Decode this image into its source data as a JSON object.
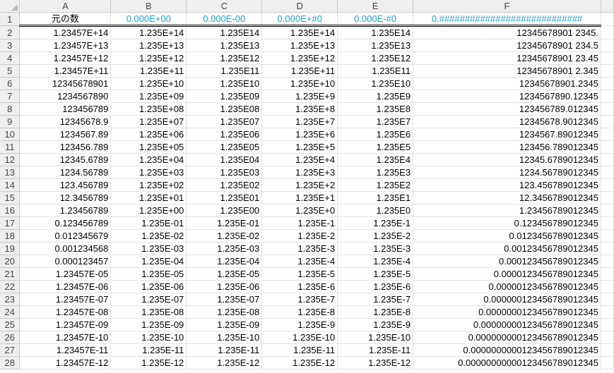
{
  "sheet": {
    "column_letters": [
      "A",
      "B",
      "C",
      "D",
      "E",
      "F"
    ],
    "row_numbers": [
      "1",
      "2",
      "3",
      "4",
      "5",
      "6",
      "7",
      "8",
      "9",
      "10",
      "11",
      "12",
      "13",
      "14",
      "15",
      "16",
      "17",
      "18",
      "19",
      "20",
      "21",
      "22",
      "23",
      "24",
      "25",
      "26",
      "27",
      "28"
    ],
    "header_row": [
      "元の数",
      "0.000E+00",
      "0.000E-00",
      "0.000E+#0",
      "0.000E-#0",
      "0.############################"
    ],
    "data_rows": [
      [
        "1.23457E+14",
        "1.235E+14",
        "1.235E14",
        "1.235E+14",
        "1.235E14",
        "12345678901 2345."
      ],
      [
        "1.23457E+13",
        "1.235E+13",
        "1.235E13",
        "1.235E+13",
        "1.235E13",
        "12345678901 234.5"
      ],
      [
        "1.23457E+12",
        "1.235E+12",
        "1.235E12",
        "1.235E+12",
        "1.235E12",
        "12345678901 23.45"
      ],
      [
        "1.23457E+11",
        "1.235E+11",
        "1.235E11",
        "1.235E+11",
        "1.235E11",
        "12345678901 2.345"
      ],
      [
        "12345678901",
        "1.235E+10",
        "1.235E10",
        "1.235E+10",
        "1.235E10",
        "12345678901.2345"
      ],
      [
        "1234567890",
        "1.235E+09",
        "1.235E09",
        "1.235E+9",
        "1.235E9",
        "1234567890.12345"
      ],
      [
        "123456789",
        "1.235E+08",
        "1.235E08",
        "1.235E+8",
        "1.235E8",
        "123456789.012345"
      ],
      [
        "12345678.9",
        "1.235E+07",
        "1.235E07",
        "1.235E+7",
        "1.235E7",
        "12345678.9012345"
      ],
      [
        "1234567.89",
        "1.235E+06",
        "1.235E06",
        "1.235E+6",
        "1.235E6",
        "1234567.89012345"
      ],
      [
        "123456.789",
        "1.235E+05",
        "1.235E05",
        "1.235E+5",
        "1.235E5",
        "123456.789012345"
      ],
      [
        "12345.6789",
        "1.235E+04",
        "1.235E04",
        "1.235E+4",
        "1.235E4",
        "12345.6789012345"
      ],
      [
        "1234.56789",
        "1.235E+03",
        "1.235E03",
        "1.235E+3",
        "1.235E3",
        "1234.56789012345"
      ],
      [
        "123.456789",
        "1.235E+02",
        "1.235E02",
        "1.235E+2",
        "1.235E2",
        "123.456789012345"
      ],
      [
        "12.3456789",
        "1.235E+01",
        "1.235E01",
        "1.235E+1",
        "1.235E1",
        "12.3456789012345"
      ],
      [
        "1.23456789",
        "1.235E+00",
        "1.235E00",
        "1.235E+0",
        "1.235E0",
        "1.23456789012345"
      ],
      [
        "0.123456789",
        "1.235E-01",
        "1.235E-01",
        "1.235E-1",
        "1.235E-1",
        "0.123456789012345"
      ],
      [
        "0.012345679",
        "1.235E-02",
        "1.235E-02",
        "1.235E-2",
        "1.235E-2",
        "0.0123456789012345"
      ],
      [
        "0.001234568",
        "1.235E-03",
        "1.235E-03",
        "1.235E-3",
        "1.235E-3",
        "0.00123456789012345"
      ],
      [
        "0.000123457",
        "1.235E-04",
        "1.235E-04",
        "1.235E-4",
        "1.235E-4",
        "0.000123456789012345"
      ],
      [
        "1.23457E-05",
        "1.235E-05",
        "1.235E-05",
        "1.235E-5",
        "1.235E-5",
        "0.0000123456789012345"
      ],
      [
        "1.23457E-06",
        "1.235E-06",
        "1.235E-06",
        "1.235E-6",
        "1.235E-6",
        "0.00000123456789012345"
      ],
      [
        "1.23457E-07",
        "1.235E-07",
        "1.235E-07",
        "1.235E-7",
        "1.235E-7",
        "0.000000123456789012345"
      ],
      [
        "1.23457E-08",
        "1.235E-08",
        "1.235E-08",
        "1.235E-8",
        "1.235E-8",
        "0.0000000123456789012345"
      ],
      [
        "1.23457E-09",
        "1.235E-09",
        "1.235E-09",
        "1.235E-9",
        "1.235E-9",
        "0.00000000123456789012345"
      ],
      [
        "1.23457E-10",
        "1.235E-10",
        "1.235E-10",
        "1.235E-10",
        "1.235E-10",
        "0.000000000123456789012345"
      ],
      [
        "1.23457E-11",
        "1.235E-11",
        "1.235E-11",
        "1.235E-11",
        "1.235E-11",
        "0.0000000000123456789012345"
      ],
      [
        "1.23457E-12",
        "1.235E-12",
        "1.235E-12",
        "1.235E-12",
        "1.235E-12",
        "0.00000000000123456789012345"
      ]
    ],
    "colors": {
      "header_text": "#1fa3c8",
      "grid": "#e2e2e2",
      "header_bg": "#efefef"
    }
  }
}
